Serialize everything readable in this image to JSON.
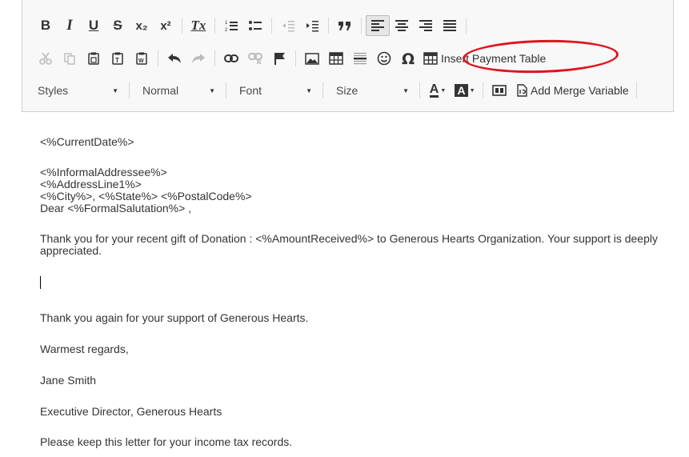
{
  "toolbar": {
    "row1": {
      "bold": "B",
      "italic": "I",
      "underline": "U",
      "strike": "S",
      "subscript": "x₂",
      "superscript": "x²",
      "remove_format": "Tx"
    },
    "insert_payment_table": "Insert Payment Table",
    "add_merge_variable": "Add Merge Variable",
    "styles": "Styles",
    "format": "Normal",
    "font": "Font",
    "size": "Size",
    "text_color": "A",
    "bg_color": "A"
  },
  "annotation": {
    "color": "#e0141e"
  },
  "document": {
    "date": "<%CurrentDate%>",
    "address_lines": [
      "<%InformalAddressee%>",
      "<%AddressLine1%>",
      "<%City%>, <%State%> <%PostalCode%>",
      "Dear <%FormalSalutation%> ,"
    ],
    "body": "Thank you for your recent gift of Donation : <%AmountReceived%>  to Generous Hearts Organization. Your support is deeply appreciated.",
    "thanks": "Thank you again for your support of Generous Hearts.",
    "closing": "Warmest regards,",
    "signer": "Jane Smith",
    "title": "Executive Director, Generous Hearts",
    "note": "Please keep this letter for your income tax records."
  }
}
